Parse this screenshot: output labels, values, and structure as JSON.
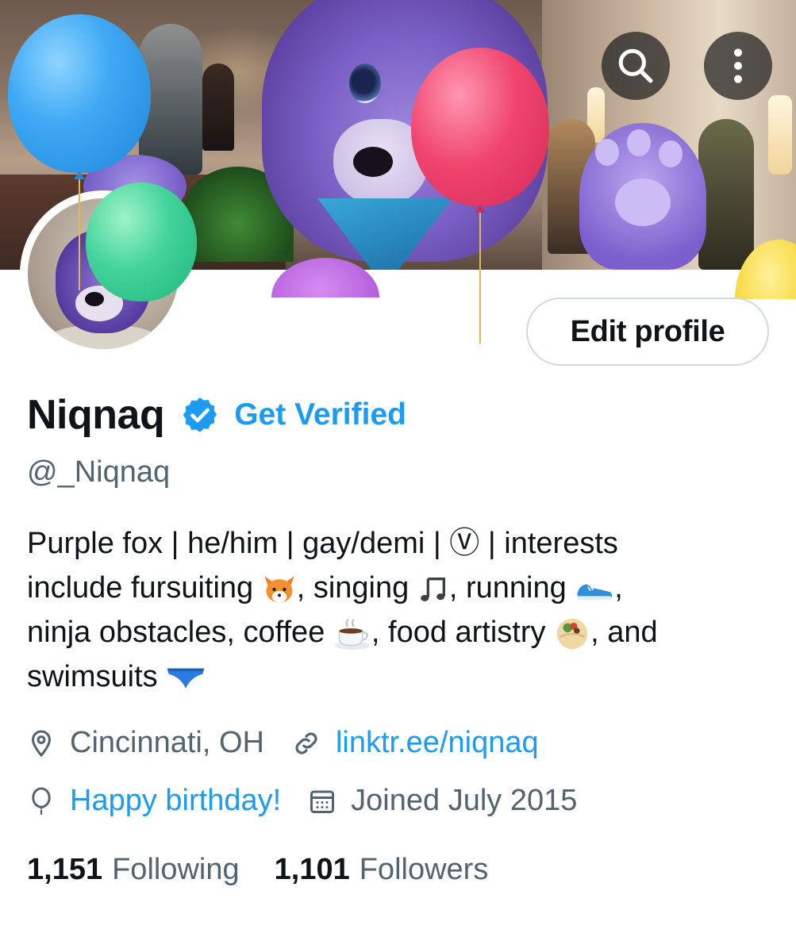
{
  "profile": {
    "display_name": "Niqnaq",
    "handle": "@_Niqnaq",
    "get_verified_label": "Get Verified",
    "edit_profile_label": "Edit profile",
    "bio": {
      "line1": "Purple fox | he/him | gay/demi | Ⓥ | interests",
      "line2_a": "include fursuiting",
      "line2_b": ", singing",
      "line2_c": ", running",
      "line2_d": ",",
      "line3_a": "ninja obstacles, coffee",
      "line3_b": ", food artistry",
      "line3_c": ", and",
      "line4_a": "swimsuits"
    },
    "location": "Cincinnati, OH",
    "website": "linktr.ee/niqnaq",
    "birthday": "Happy birthday!",
    "joined": "Joined July 2015",
    "following_count": "1,151",
    "following_label": "Following",
    "followers_count": "1,101",
    "followers_label": "Followers"
  },
  "icons": {
    "search": "search-icon",
    "more": "more-vertical-icon",
    "verified": "verified-badge-icon",
    "location": "location-pin-icon",
    "link": "link-icon",
    "birthday": "balloon-icon",
    "calendar": "calendar-icon"
  },
  "colors": {
    "accent": "#1d9bf0",
    "text_primary": "#0f1419",
    "text_secondary": "#536471",
    "border": "#cfd9de"
  }
}
